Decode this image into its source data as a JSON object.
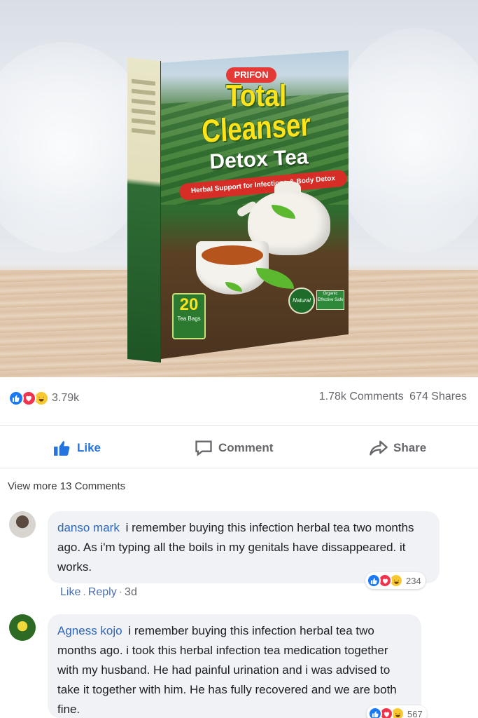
{
  "product": {
    "brand": "PRIFON",
    "title_line1": "Total",
    "title_line2": "Cleanser",
    "title_line3": "Detox Tea",
    "tagline": "Herbal Support for Infections & Body Detox",
    "count_number": "20",
    "count_label": "Tea Bags",
    "badge_natural": "Natural",
    "badge_organic": "Organic Effective Safe"
  },
  "post_stats": {
    "reaction_icons": [
      "like-icon",
      "love-icon",
      "haha-icon"
    ],
    "reaction_count": "3.79k",
    "comments": "1.78k Comments",
    "shares": "674 Shares"
  },
  "actions": {
    "like": "Like",
    "comment": "Comment",
    "share": "Share"
  },
  "comments_section": {
    "view_more": "View more 13 Comments",
    "comments": [
      {
        "author": "danso mark",
        "text": "i remember buying this infection herbal tea two months ago. As i'm typing all the boils in my genitals have dissappeared. it works.",
        "like": "Like",
        "reply": "Reply",
        "age": "3d",
        "reaction_count": "234"
      },
      {
        "author": "Agness kojo",
        "text": "i remember buying this infection herbal tea two months ago. i took this herbal infection tea medication together with my husband. He had painful urination and i was advised to take it together with him. He has fully recovered and we are both fine.",
        "reaction_count": "567"
      }
    ]
  },
  "colors": {
    "facebook_blue": "#2374e1",
    "author_blue": "#2e66b8",
    "bubble_bg": "#f0f2f5",
    "love_red": "#f0344d",
    "haha_yellow": "#f7c832"
  }
}
